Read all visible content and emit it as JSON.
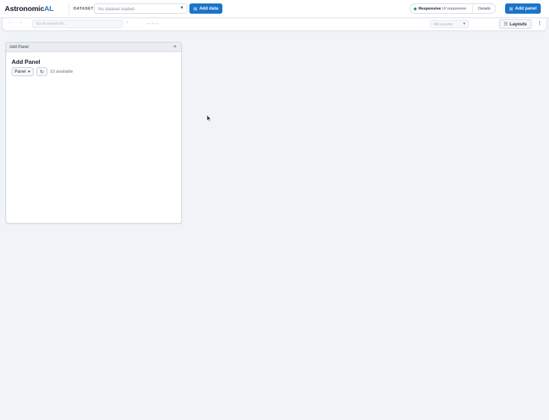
{
  "app": {
    "logo_main": "Astronomic",
    "logo_accent": "AL"
  },
  "header": {
    "dataset_label": "DATASET",
    "dataset_select_value": "No dataset loaded",
    "add_data_label": "Add data",
    "status_main": "Responsive",
    "status_sub": "UI responsive",
    "status_details": "Details",
    "add_panel_label": "Add panel"
  },
  "toolbar": {
    "goto_placeholder": "Go to record ID…",
    "record_position": "— / —",
    "records_filter": "All records",
    "layouts_label": "Layouts",
    "more_icon": "⋮"
  },
  "panel": {
    "header_title": "Add Panel",
    "close_icon": "×",
    "title": "Add Panel",
    "select_value": "Panel",
    "refresh_icon": "↻",
    "available_text": "33 available"
  },
  "colors": {
    "accent": "#1b74c9",
    "status_dot": "#16a34a",
    "background": "#f0f3f7"
  }
}
